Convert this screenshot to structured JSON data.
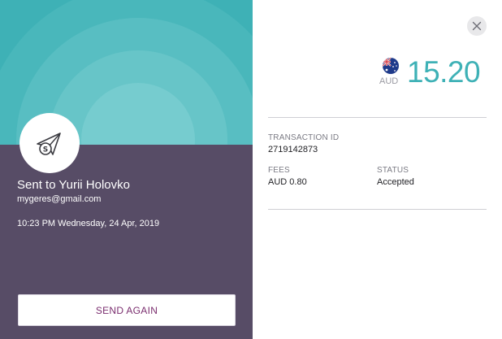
{
  "recipient": {
    "name": "Sent to Yurii Holovko",
    "email": "mygeres@gmail.com",
    "datetime": "10:23 PM Wednesday, 24 Apr, 2019"
  },
  "actions": {
    "send_again_label": "SEND AGAIN"
  },
  "amount": {
    "currency": "AUD",
    "value": "15.20",
    "flag_icon": "australia-flag-icon"
  },
  "details": {
    "transaction_id_label": "TRANSACTION ID",
    "transaction_id_value": "2719142873",
    "fees_label": "FEES",
    "fees_value": "AUD 0.80",
    "status_label": "STATUS",
    "status_value": "Accepted"
  },
  "colors": {
    "accent_teal": "#3eb1b6",
    "panel_purple": "#574c66",
    "button_text": "#7a2d6e"
  }
}
